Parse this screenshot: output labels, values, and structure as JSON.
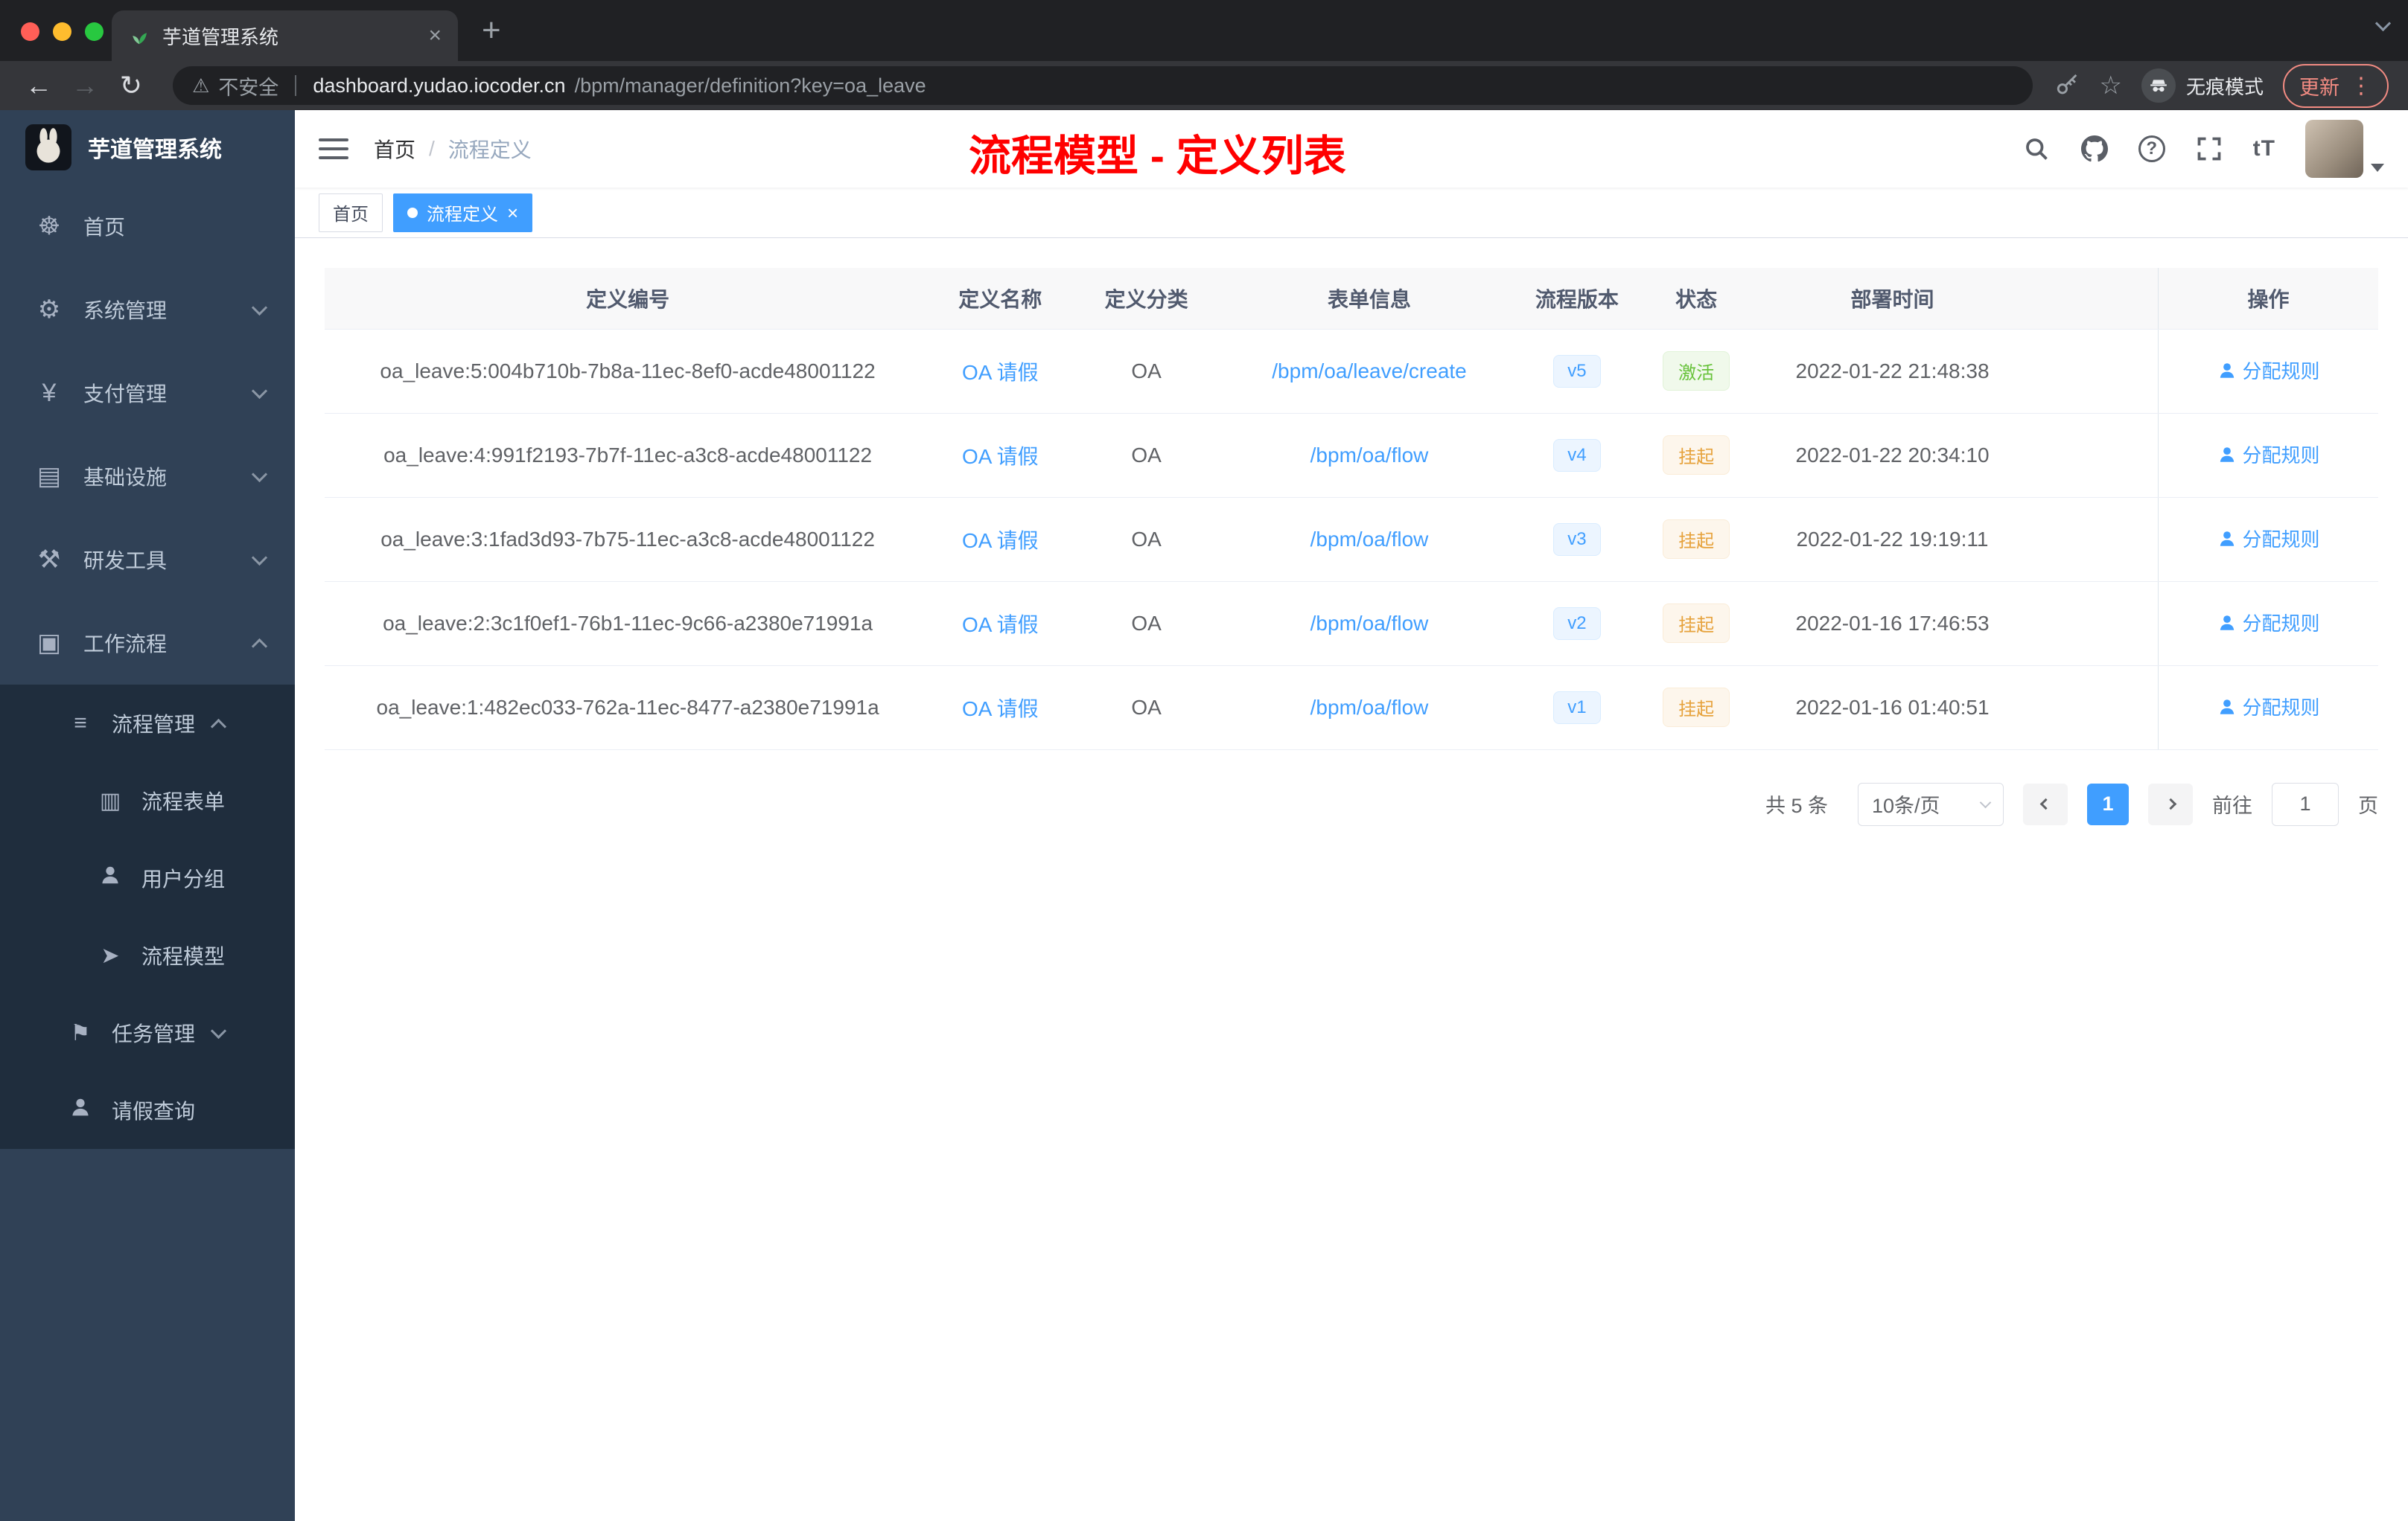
{
  "browser": {
    "tab_title": "芋道管理系统",
    "security_label": "不安全",
    "url_host": "dashboard.yudao.iocoder.cn",
    "url_path": "/bpm/manager/definition?key=oa_leave",
    "incognito_label": "无痕模式",
    "update_label": "更新"
  },
  "icons": {
    "back": "←",
    "forward": "→",
    "reload": "↻",
    "warning": "⚠",
    "star": "☆",
    "menu_dots": "⋮",
    "new_tab": "+",
    "close": "×",
    "home": "☸",
    "system": "⚙",
    "payment": "¥",
    "infra": "▤",
    "devtools": "⚒",
    "workflow": "▣",
    "process_mgmt": "≡",
    "process_form": "▥",
    "process_model": "➤",
    "task_mgmt": "⚑",
    "question": "?",
    "font_size": "tT"
  },
  "sidebar": {
    "logo_title": "芋道管理系统",
    "items": [
      {
        "label": "首页"
      },
      {
        "label": "系统管理"
      },
      {
        "label": "支付管理"
      },
      {
        "label": "基础设施"
      },
      {
        "label": "研发工具"
      },
      {
        "label": "工作流程"
      },
      {
        "label": "流程管理"
      },
      {
        "label": "流程表单"
      },
      {
        "label": "用户分组"
      },
      {
        "label": "流程模型"
      },
      {
        "label": "任务管理"
      },
      {
        "label": "请假查询"
      }
    ]
  },
  "header": {
    "breadcrumb_home": "首页",
    "breadcrumb_separator": "/",
    "breadcrumb_current": "流程定义",
    "annotation": "流程模型 - 定义列表"
  },
  "tags": {
    "home": "首页",
    "current": "流程定义"
  },
  "table": {
    "columns": [
      "定义编号",
      "定义名称",
      "定义分类",
      "表单信息",
      "流程版本",
      "状态",
      "部署时间",
      "操作"
    ],
    "rows": [
      {
        "id": "oa_leave:5:004b710b-7b8a-11ec-8ef0-acde48001122",
        "name": "OA 请假",
        "category": "OA",
        "form": "/bpm/oa/leave/create",
        "version": "v5",
        "status": "激活",
        "time": "2022-01-22 21:48:38",
        "action": "分配规则"
      },
      {
        "id": "oa_leave:4:991f2193-7b7f-11ec-a3c8-acde48001122",
        "name": "OA 请假",
        "category": "OA",
        "form": "/bpm/oa/flow",
        "version": "v4",
        "status": "挂起",
        "time": "2022-01-22 20:34:10",
        "action": "分配规则"
      },
      {
        "id": "oa_leave:3:1fad3d93-7b75-11ec-a3c8-acde48001122",
        "name": "OA 请假",
        "category": "OA",
        "form": "/bpm/oa/flow",
        "version": "v3",
        "status": "挂起",
        "time": "2022-01-22 19:19:11",
        "action": "分配规则"
      },
      {
        "id": "oa_leave:2:3c1f0ef1-76b1-11ec-9c66-a2380e71991a",
        "name": "OA 请假",
        "category": "OA",
        "form": "/bpm/oa/flow",
        "version": "v2",
        "status": "挂起",
        "time": "2022-01-16 17:46:53",
        "action": "分配规则"
      },
      {
        "id": "oa_leave:1:482ec033-762a-11ec-8477-a2380e71991a",
        "name": "OA 请假",
        "category": "OA",
        "form": "/bpm/oa/flow",
        "version": "v1",
        "status": "挂起",
        "time": "2022-01-16 01:40:51",
        "action": "分配规则"
      }
    ]
  },
  "pagination": {
    "total_label": "共 5 条",
    "page_size_label": "10条/页",
    "current_page": "1",
    "goto_label": "前往",
    "goto_value": "1",
    "page_unit": "页"
  },
  "colors": {
    "accent": "#409eff",
    "success": "#67c23a",
    "warning": "#e6a23c",
    "sidebar_bg": "#304156",
    "submenu_bg": "#1f2d3d",
    "annotation": "#ff0000"
  }
}
